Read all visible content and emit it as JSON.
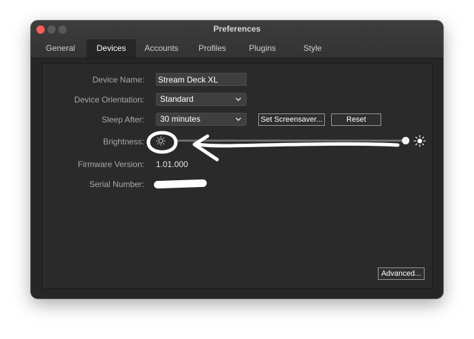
{
  "window": {
    "title": "Preferences"
  },
  "tabs": [
    {
      "label": "General",
      "active": false
    },
    {
      "label": "Devices",
      "active": true
    },
    {
      "label": "Accounts",
      "active": false
    },
    {
      "label": "Profiles",
      "active": false
    },
    {
      "label": "Plugins",
      "active": false
    },
    {
      "label": "Style",
      "active": false
    }
  ],
  "device": {
    "name_label": "Device Name:",
    "name_value": "Stream Deck XL",
    "orientation_label": "Device Orientation:",
    "orientation_value": "Standard",
    "sleep_label": "Sleep After:",
    "sleep_value": "30 minutes",
    "set_screensaver_label": "Set Screensaver...",
    "reset_label": "Reset",
    "brightness_label": "Brightness:",
    "brightness_level": 1.0,
    "firmware_label": "Firmware Version:",
    "firmware_value": "1.01.000",
    "serial_label": "Serial Number:",
    "advanced_label": "Advanced..."
  },
  "icons": {
    "dropdown": "chevron-down-icon",
    "brightness_low": "sun-low-icon",
    "brightness_high": "sun-high-icon"
  },
  "colors": {
    "window_bg": "#262626",
    "titlebar_bg": "#383838",
    "close_button": "#ff5f57",
    "annotation": "#ffffff"
  }
}
